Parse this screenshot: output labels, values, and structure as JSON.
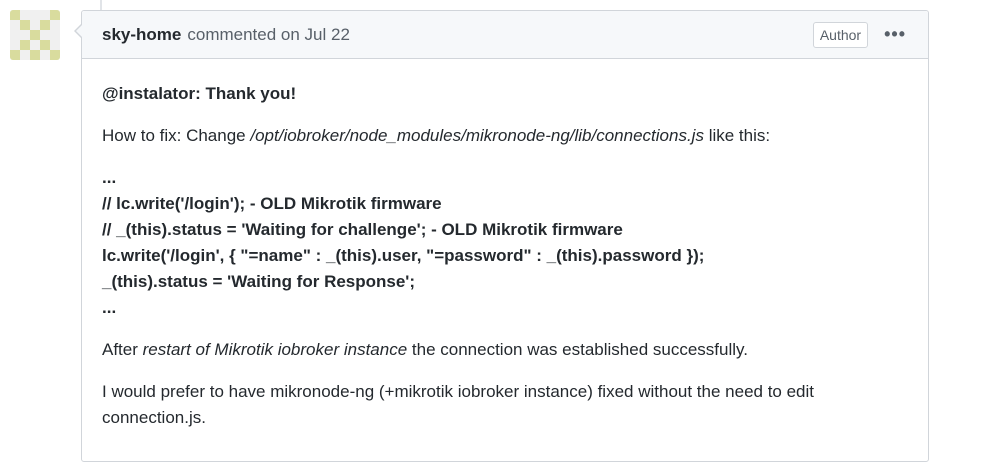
{
  "comment": {
    "author": "sky-home",
    "action": "commented on Jul 22",
    "badge": "Author",
    "more_icon": "kebab-horizontal-icon",
    "mention": "@instalator:",
    "thanks": " Thank you!",
    "howto_prefix": "How to fix: Change ",
    "howto_path": "/opt/iobroker/node_modules/mikronode-ng/lib/connections.js",
    "howto_suffix": " like this:",
    "code_lines": [
      "...",
      "// lc.write('/login'); - OLD Mikrotik firmware",
      "// _(this).status = 'Waiting for challenge'; - OLD Mikrotik firmware",
      "lc.write('/login', { \"=name\" : _(this).user, \"=password\" : _(this).password });",
      "_(this).status = 'Waiting for Response';",
      "..."
    ],
    "after_prefix": "After ",
    "after_em": "restart of Mikrotik iobroker instance",
    "after_suffix": " the connection was established successfully.",
    "prefer_text": "I would prefer to have mikronode-ng (+mikrotik iobroker instance) fixed without the need to edit connection.js."
  },
  "colors": {
    "border": "#d1d5da",
    "header_bg": "#f6f8fa",
    "text": "#24292e",
    "muted": "#586069",
    "avatar_fg": "#d9dc9e"
  }
}
